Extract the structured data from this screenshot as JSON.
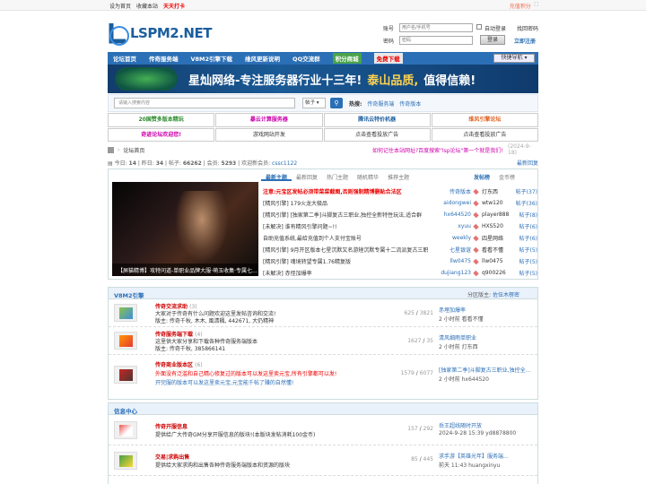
{
  "topbar": {
    "set_home": "设为首页",
    "bookmark": "收藏本站",
    "daily": "天天打卡",
    "recharge": "充值积分"
  },
  "logo": {
    "text": "LSPM2.NET"
  },
  "login": {
    "account_label": "账号",
    "account_placeholder": "用户名/手机号",
    "password_label": "密码",
    "password_placeholder": "密码",
    "auto_login": "自动登录",
    "forgot": "找回密码",
    "login_btn": "登录",
    "register": "立即注册"
  },
  "nav": {
    "items": [
      "论坛首页",
      "传奇服务端",
      "V8M2引擎下载",
      "维风更新说明",
      "QQ交流群",
      "积分商城",
      "免费下载"
    ],
    "quick": "快捷导航"
  },
  "banner": {
    "t1": "星灿网络-专注服务器行业十三年!",
    "t2": "泰山品质,",
    "t3": "值得信赖!"
  },
  "search": {
    "placeholder": "请输入搜索内容",
    "type": "帖子",
    "hot_label": "热搜:",
    "hot": [
      "传奇服务端",
      "传奇版本"
    ]
  },
  "ads": [
    {
      "text": "20国赞多版本精玩",
      "color": "#2a8a2a"
    },
    {
      "text": "暴云计算服务器",
      "color": "#c0a"
    },
    {
      "text": "腾讯云特价机器",
      "color": "#1b5e9e"
    },
    {
      "text": "维风引擎论坛",
      "color": "#e06020"
    },
    {
      "text": "奇迹论坛欢迎您!",
      "color": "#c0a"
    },
    {
      "text": "游戏网站开发",
      "color": "#333"
    },
    {
      "text": "点击查看投放广告",
      "color": "#333"
    },
    {
      "text": "点击查看投放广告",
      "color": "#333"
    }
  ],
  "breadcrumb": {
    "home": "论坛首页",
    "hint": "如何记住本站网址?百度搜索\"lsp论坛\"第一个就是我们!",
    "date": "(2024-9-18)"
  },
  "stats": {
    "today_label": "今日:",
    "today": "14",
    "yesterday_label": "昨日:",
    "yesterday": "34",
    "posts_label": "帖子:",
    "posts": "66262",
    "members_label": "会员:",
    "members": "5293",
    "welcome": "欢迎新会员:",
    "new_member": "cssc1122",
    "latest": "最新回复"
  },
  "show": {
    "tabs": [
      "最新主题",
      "最新回复",
      "热门主题",
      "随机精华",
      "推荐主题"
    ],
    "tabs2": [
      "发帖榜",
      "金币榜"
    ],
    "slide_caption": "【屏猫精博】攻特问道-单职业品牌大服·萌玉收集·专属七...",
    "topics": [
      {
        "t": "注意:元宝区发帖必须带菜菜截图,否则强制精博删贴合法区",
        "a": "传奇版本",
        "red": true
      },
      {
        "t": "[精风引擎] 179火龙大极品",
        "a": "aidongwei"
      },
      {
        "t": "[精风引擎] [独家第二季]斗脚复古三职业,独控全新特性玩法,适合群",
        "a": "hx644520"
      },
      {
        "t": "[未解决] 谁有精风引擎问题~!!",
        "a": "xyuu"
      },
      {
        "t": "自助充值系统,最给充值到个人支付宝账号",
        "a": "weekly"
      },
      {
        "t": "[精风引擎] 9月开区版本七星沉默又名游矬沉默专属十二流派复古三职",
        "a": "七星银谊"
      },
      {
        "t": "[精风引擎] 魂境转望专属1.76精复版",
        "a": "llw0475"
      },
      {
        "t": "[未解决] 赤怪加爆率",
        "a": "dujiang123"
      }
    ],
    "rank": [
      {
        "n": "灯东西",
        "c": "帖子(37)"
      },
      {
        "n": "wtw120",
        "c": "帖子(36)"
      },
      {
        "n": "player888",
        "c": "帖子(8)"
      },
      {
        "n": "HXS520",
        "c": "帖子(6)"
      },
      {
        "n": "四星网络",
        "c": "帖子(6)"
      },
      {
        "n": "看看不懂",
        "c": "帖子(5)"
      },
      {
        "n": "llw0475",
        "c": "帖子(5)"
      },
      {
        "n": "q900226",
        "c": "帖子(5)"
      }
    ]
  },
  "section1": {
    "title": "V8M2引擎",
    "mod_label": "分区版主:",
    "mod": "佐伍木楞密",
    "forums": [
      {
        "name": "传奇交流求助",
        "num": "(3)",
        "d1": "大家对于传奇有什么问题欢迎这里发帖咨询和交流!",
        "d2": "版主: 传奇千秋, 木木, 風清楓, 442671, 大仍精神",
        "c1": "625",
        "c2": "3821",
        "l1": "赤埋加爆率",
        "l2": "2 小时前 看看不懂"
      },
      {
        "name": "传奇服务端下载",
        "num": "(4)",
        "d1": "这里供大家分享和下载各种传奇服务端版本",
        "d2": "版主: 传奇千秋, 385866141",
        "c1": "1627",
        "c2": "35",
        "l1": "清风细雨单职业",
        "l2": "2 小时前 灯东西"
      },
      {
        "name": "传奇商业版本区",
        "num": "(6)",
        "d1": "外面没有泛滥和自己精心修复过的版本可以发这里卖元宝,所有引擎都可以发!",
        "d2": "开完服的版本可以发这里卖元宝,元宝能千帖了赚的自然懂!",
        "c1": "1579",
        "c2": "6077",
        "l1": "[独家第二季]斗脚复古三职业,独控全...",
        "l2": "2 小时前 hx644520"
      }
    ]
  },
  "section2": {
    "title": "信息中心",
    "forums": [
      {
        "name": "传奇开服信息",
        "num": "",
        "d1": "提供给广大传奇GM分享开服信息的版块!(本版块发帖消耗100金币)",
        "d2": "",
        "c1": "157",
        "c2": "292",
        "l1": "岳王超线随时开放",
        "l2": "2024-9-28 15:39 yd8878800"
      },
      {
        "name": "交易|求购出售",
        "num": "",
        "d1": "提供给大家求购和出售各种传奇服务端版本和资源的版块",
        "d2": "",
        "c1": "85",
        "c2": "445",
        "l1": "求手游【英雄光年】服务端...",
        "l2": "前天 11:43 huangxinyu"
      }
    ]
  }
}
